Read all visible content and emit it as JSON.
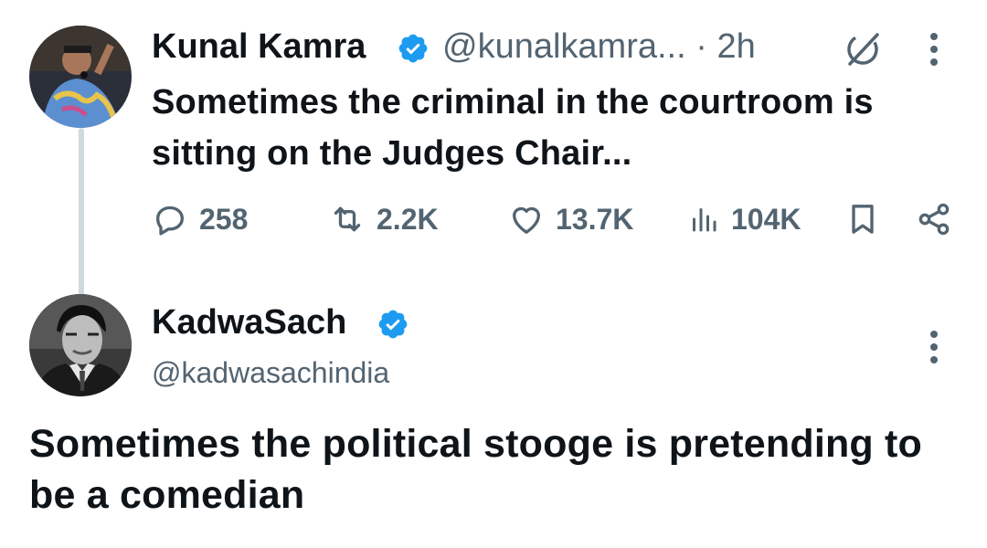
{
  "tweet1": {
    "author_name": "Kunal Kamra",
    "author_handle": "@kunalkamra...",
    "time": "· 2h",
    "verified": true,
    "text": "Sometimes the criminal in the courtroom is sitting on the Judges Chair...",
    "stats": {
      "replies": "258",
      "retweets": "2.2K",
      "likes": "13.7K",
      "views": "104K"
    }
  },
  "tweet2": {
    "author_name": "KadwaSach",
    "author_handle": "@kadwasachindia",
    "verified": true,
    "text": "Sometimes the political stooge is pretending to be a comedian"
  },
  "colors": {
    "text_primary": "#0f1419",
    "text_secondary": "#536471",
    "verified_blue": "#1d9bf0",
    "thread_line": "#cfd9de"
  },
  "icons": {
    "verified": "verified-badge-icon",
    "grok": "grok-icon",
    "more": "more-options-icon",
    "reply": "reply-icon",
    "retweet": "retweet-icon",
    "like": "heart-icon",
    "views": "views-chart-icon",
    "bookmark": "bookmark-icon",
    "share": "share-icon"
  }
}
